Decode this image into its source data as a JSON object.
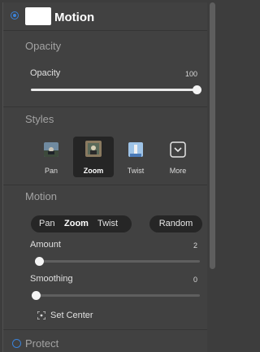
{
  "header": {
    "title": "Motion"
  },
  "opacity_section": {
    "title": "Opacity",
    "slider_label": "Opacity",
    "value_text": "100",
    "value": 100,
    "min": 0,
    "max": 100
  },
  "styles_section": {
    "title": "Styles",
    "items": [
      {
        "label": "Pan",
        "icon": "pan-thumbnail-icon",
        "selected": false
      },
      {
        "label": "Zoom",
        "icon": "zoom-thumbnail-icon",
        "selected": true
      },
      {
        "label": "Twist",
        "icon": "twist-thumbnail-icon",
        "selected": false
      },
      {
        "label": "More",
        "icon": "chevron-down-icon",
        "selected": false
      }
    ]
  },
  "motion_section": {
    "title": "Motion",
    "segments": [
      {
        "label": "Pan",
        "active": false
      },
      {
        "label": "Zoom",
        "active": true
      },
      {
        "label": "Twist",
        "active": false
      }
    ],
    "random_label": "Random",
    "amount": {
      "label": "Amount",
      "value_text": "2",
      "value": 2,
      "min": 0,
      "max": 100
    },
    "smoothing": {
      "label": "Smoothing",
      "value_text": "0",
      "value": 0,
      "min": 0,
      "max": 100
    },
    "set_center_label": "Set Center"
  },
  "protect": {
    "label": "Protect"
  },
  "colors": {
    "accent": "#3b82d8",
    "panel": "#414141",
    "dark": "#262626"
  }
}
